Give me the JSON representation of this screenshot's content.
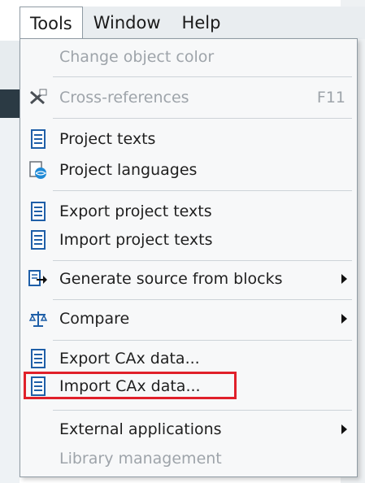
{
  "menubar": {
    "items": [
      "Tools",
      "Window",
      "Help"
    ]
  },
  "menu": {
    "change_object_color": "Change object color",
    "cross_references": "Cross-references",
    "cross_references_shortcut": "F11",
    "project_texts": "Project texts",
    "project_languages": "Project languages",
    "export_project_texts": "Export project texts",
    "import_project_texts": "Import project texts",
    "generate_source": "Generate source from blocks",
    "compare": "Compare",
    "export_cax": "Export CAx data...",
    "import_cax": "Import CAx data...",
    "external_applications": "External applications",
    "library_management": "Library management"
  },
  "colors": {
    "highlight_box": "#e0202a",
    "icon_blue": "#1f5fa8",
    "disabled_text": "#9ea4aa"
  },
  "icons": {
    "doc": "text-document-icon",
    "languages": "project-languages-icon",
    "cross_ref": "cross-references-icon",
    "generate": "generate-source-icon",
    "compare": "compare-scales-icon"
  }
}
